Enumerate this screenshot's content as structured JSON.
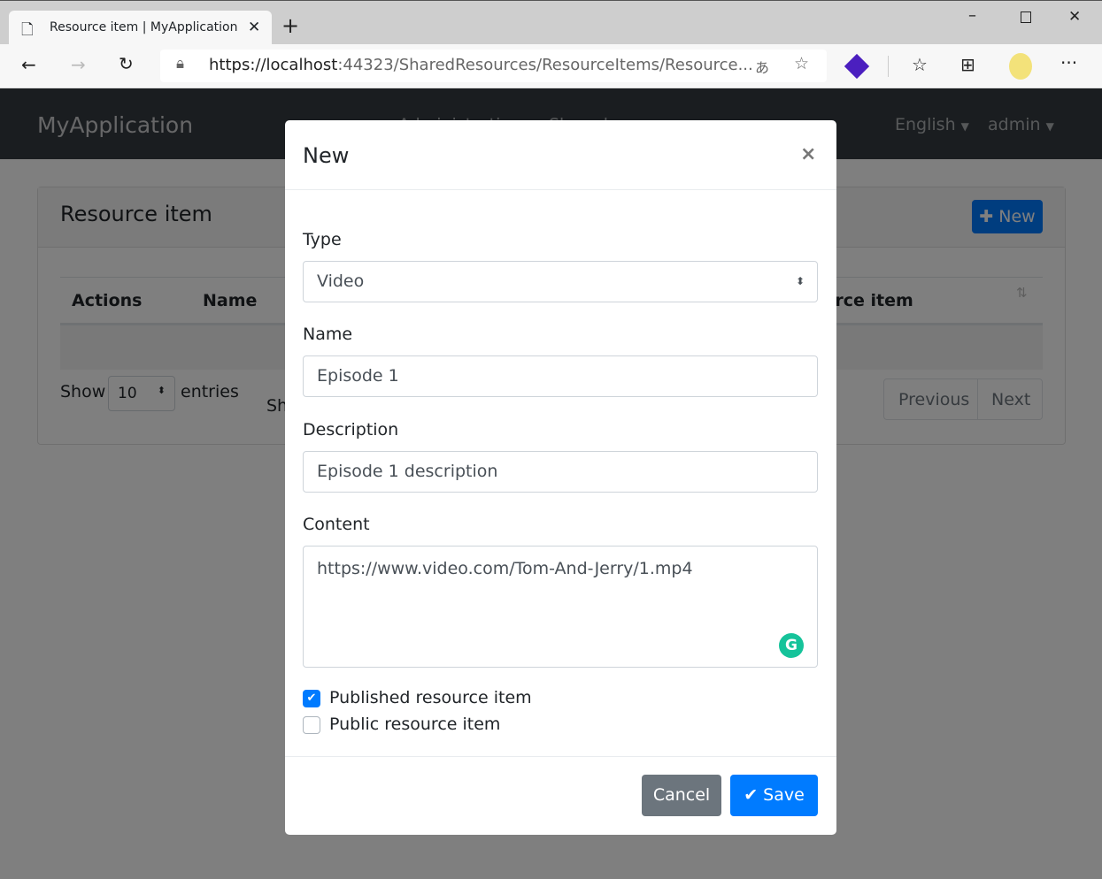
{
  "browser": {
    "tab_title": "Resource item | MyApplication",
    "url_host": "https://localhost",
    "url_rest": ":44323/SharedResources/ResourceItems/Resource..."
  },
  "navbar": {
    "brand": "MyApplication",
    "menu": [
      "Administration",
      "Shared"
    ],
    "language": "English",
    "user": "admin"
  },
  "card": {
    "title": "Resource item",
    "new_button": "New",
    "columns": [
      "Actions",
      "Name",
      "Resource item"
    ],
    "show": "Show",
    "page_size": "10",
    "entries": "entries",
    "info": "Sh",
    "previous": "Previous",
    "next": "Next"
  },
  "modal": {
    "title": "New",
    "type_label": "Type",
    "type_value": "Video",
    "name_label": "Name",
    "name_value": "Episode 1",
    "description_label": "Description",
    "description_value": "Episode 1 description",
    "content_label": "Content",
    "content_value": "https://www.video.com/Tom-And-Jerry/1.mp4",
    "published_label": "Published resource item",
    "published_checked": true,
    "public_label": "Public resource item",
    "public_checked": false,
    "cancel": "Cancel",
    "save": "Save"
  },
  "colors": {
    "primary": "#007bff",
    "secondary": "#6c757d",
    "navbar": "#343a40",
    "grammarly": "#15c39a"
  }
}
